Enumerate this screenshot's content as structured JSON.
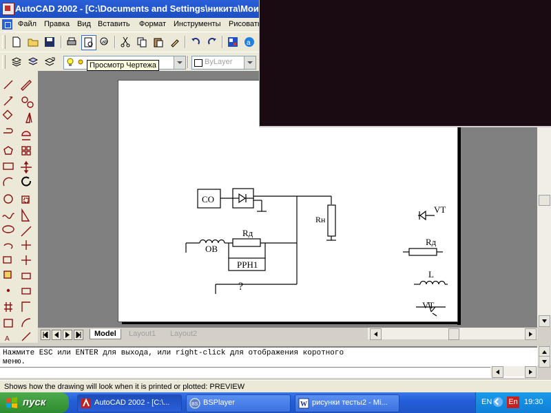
{
  "window": {
    "title": "AutoCAD 2002 - [C:\\Documents and Settings\\никита\\Мои"
  },
  "menu": {
    "items": [
      "Файл",
      "Правка",
      "Вид",
      "Вставить",
      "Формат",
      "Инструменты",
      "Рисовать"
    ]
  },
  "toolbar": {
    "tooltip": "Просмотр Чертежа",
    "layer_combo": "ByLayer",
    "icons": [
      "new-icon",
      "open-icon",
      "save-icon",
      "print-icon",
      "print-preview-icon",
      "spell-check-icon",
      "cut-icon",
      "copy-icon",
      "paste-icon",
      "match-properties-icon",
      "undo-icon",
      "redo-icon",
      "design-center-icon",
      "autocad-today-icon"
    ]
  },
  "drawing": {
    "co_label": "CO",
    "ob_label": "OB",
    "rd_label": "Rд",
    "prn_label": "PPH1",
    "question_label": "?",
    "rn_label": "Rн",
    "legend_vt_label": "VT",
    "legend_rd_label": "Rд",
    "legend_l_label": "L",
    "legend_vt2_label": "VT"
  },
  "tabs": {
    "model": "Model",
    "layout1": "Layout1",
    "layout2": "Layout2"
  },
  "command": {
    "line1": "Нажмите ESC или ENTER для выхода, или right-click для отображения коротного",
    "line2": "меню."
  },
  "status": {
    "text": "Shows how the drawing will look when it is printed or plotted:  PREVIEW"
  },
  "taskbar": {
    "start": "пуск",
    "items": [
      {
        "label": "AutoCAD 2002 - [C:\\..."
      },
      {
        "label": "BSPlayer"
      },
      {
        "label": "рисунки тесты2 - Mi..."
      }
    ],
    "lang": "EN",
    "lang_badge": "En",
    "clock": "19:30"
  },
  "colors": {
    "titlebar": "#2a5fd8",
    "taskbar": "#245ed8",
    "start": "#3a9a3a",
    "paper_bg": "#808080"
  }
}
